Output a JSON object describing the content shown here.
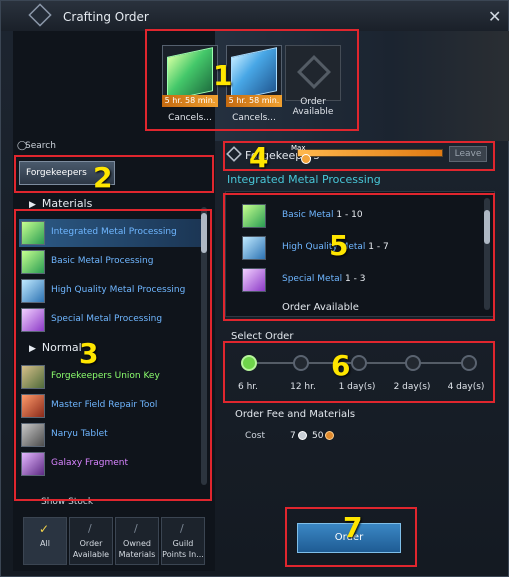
{
  "window": {
    "title": "Crafting Order",
    "close_label": "✕"
  },
  "slots": [
    {
      "time": "5 hr. 58 min.",
      "label": "Cancels..."
    },
    {
      "time": "5 hr. 58 min.",
      "label": "Cancels..."
    },
    {
      "time": "",
      "label": "Order Available"
    }
  ],
  "search": {
    "label": "Search",
    "icon": "◯",
    "filter_value": "Forgekeepers"
  },
  "categories": {
    "materials": "Materials",
    "normal": "Normal"
  },
  "items": [
    {
      "name": "Integrated Metal Processing",
      "color": "#6fb6ff",
      "icon": "green-ingot-icon"
    },
    {
      "name": "Basic Metal Processing",
      "color": "#6fb6ff",
      "icon": "c-metal-icon"
    },
    {
      "name": "High Quality Metal Processing",
      "color": "#6fb6ff",
      "icon": "c-metal-icon"
    },
    {
      "name": "Special Metal Processing",
      "color": "#6fb6ff",
      "icon": "purple-metal-icon"
    },
    {
      "name": "Forgekeepers Union Key",
      "color": "#8cff6e",
      "icon": "key-icon"
    },
    {
      "name": "Master Field Repair Tool",
      "color": "#6fb6ff",
      "icon": "repair-tool-icon"
    },
    {
      "name": "Naryu Tablet",
      "color": "#6fb6ff",
      "icon": "tablet-icon"
    },
    {
      "name": "Galaxy Fragment",
      "color": "#d884ff",
      "icon": "fragment-icon"
    }
  ],
  "show_stock": "Show Stock",
  "bottom_tabs": [
    {
      "label": "All"
    },
    {
      "label": "Order Available"
    },
    {
      "label": "Owned Materials"
    },
    {
      "label": "Guild Points In..."
    }
  ],
  "faction": {
    "name": "Forgekeepers",
    "max_label": "Max",
    "progress": 1.0,
    "leave_label": "Leave"
  },
  "recipe_title": "Integrated Metal Processing",
  "materials": [
    {
      "name": "Basic Metal",
      "qty": "1 - 10",
      "color": "#6fb6ff"
    },
    {
      "name": "High Quality Metal",
      "qty": "1 - 7",
      "color": "#6fb6ff"
    },
    {
      "name": "Special Metal",
      "qty": "1 - 3",
      "color": "#6fb6ff"
    }
  ],
  "order_available": "Order Available",
  "select_order": {
    "title": "Select Order",
    "options": [
      "6 hr.",
      "12 hr.",
      "1 day(s)",
      "2 day(s)",
      "4 day(s)"
    ],
    "selected_index": 0
  },
  "fee": {
    "title": "Order Fee and Materials",
    "cost_label": "Cost",
    "silver": "7",
    "bronze": "50"
  },
  "order_button": "Order",
  "callouts": [
    "1",
    "2",
    "3",
    "4",
    "5",
    "6",
    "7"
  ],
  "colors": {
    "accent": "#48c7d8",
    "highlight_box": "#e0262e",
    "callout_text": "#ffe600"
  }
}
